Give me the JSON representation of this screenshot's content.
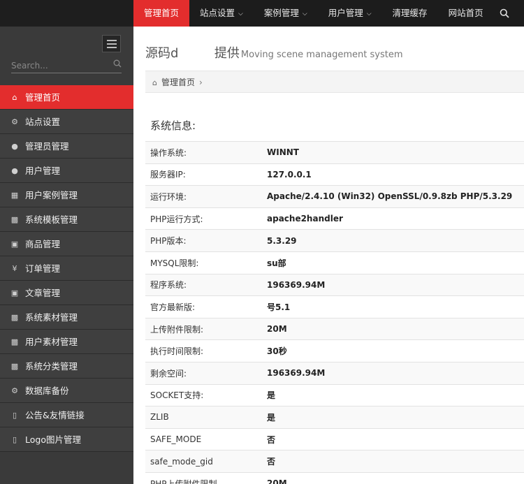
{
  "topnav": {
    "items": [
      {
        "label": "管理首页",
        "active": true,
        "dropdown": false
      },
      {
        "label": "站点设置",
        "active": false,
        "dropdown": true
      },
      {
        "label": "案例管理",
        "active": false,
        "dropdown": true
      },
      {
        "label": "用户管理",
        "active": false,
        "dropdown": true
      },
      {
        "label": "清理缓存",
        "active": false,
        "dropdown": false
      },
      {
        "label": "网站首页",
        "active": false,
        "dropdown": false
      }
    ],
    "search_icon": "search-icon"
  },
  "sidebar": {
    "search_placeholder": "Search...",
    "items": [
      {
        "label": "管理首页",
        "icon": "home-icon",
        "active": true
      },
      {
        "label": "站点设置",
        "icon": "gears-icon",
        "active": false
      },
      {
        "label": "管理员管理",
        "icon": "user-icon",
        "active": false
      },
      {
        "label": "用户管理",
        "icon": "user-icon",
        "active": false
      },
      {
        "label": "用户案例管理",
        "icon": "table-icon",
        "active": false
      },
      {
        "label": "系统模板管理",
        "icon": "briefcase-icon",
        "active": false
      },
      {
        "label": "商品管理",
        "icon": "caret-square-icon",
        "active": false
      },
      {
        "label": "订单管理",
        "icon": "yen-icon",
        "active": false
      },
      {
        "label": "文章管理",
        "icon": "caret-square-icon",
        "active": false
      },
      {
        "label": "系统素材管理",
        "icon": "gift-icon",
        "active": false
      },
      {
        "label": "用户素材管理",
        "icon": "gift-icon",
        "active": false
      },
      {
        "label": "系统分类管理",
        "icon": "briefcase-icon",
        "active": false
      },
      {
        "label": "数据库备份",
        "icon": "gears-icon",
        "active": false
      },
      {
        "label": "公告&友情链接",
        "icon": "bookmark-icon",
        "active": false
      },
      {
        "label": "Logo图片管理",
        "icon": "bookmark-icon",
        "active": false
      }
    ]
  },
  "header": {
    "title": "源码d         提供",
    "subtitle": "Moving scene management system"
  },
  "breadcrumb": {
    "home": "管理首页"
  },
  "system_info": {
    "title": "系统信息:",
    "rows": [
      {
        "label": "操作系统:",
        "value": "WINNT"
      },
      {
        "label": "服务器IP:",
        "value": "127.0.0.1"
      },
      {
        "label": "运行环境:",
        "value": "Apache/2.4.10 (Win32) OpenSSL/0.9.8zb PHP/5.3.29"
      },
      {
        "label": "PHP运行方式:",
        "value": "apache2handler"
      },
      {
        "label": "PHP版本:",
        "value": "5.3.29"
      },
      {
        "label": "MYSQL限制:",
        "value": "su部"
      },
      {
        "label": "程序系统:",
        "value": "196369.94M"
      },
      {
        "label": "官方最新版:",
        "value": "号5.1"
      },
      {
        "label": "上传附件限制:",
        "value": "20M"
      },
      {
        "label": "执行时间限制:",
        "value": "30秒"
      },
      {
        "label": "剩余空间:",
        "value": "196369.94M"
      },
      {
        "label": "SOCKET支持:",
        "value": "是"
      },
      {
        "label": "ZLIB",
        "value": "是"
      },
      {
        "label": "SAFE_MODE",
        "value": "否"
      },
      {
        "label": "safe_mode_gid",
        "value": "否"
      },
      {
        "label": "PHP上传附件限制",
        "value": "20M"
      }
    ]
  }
}
